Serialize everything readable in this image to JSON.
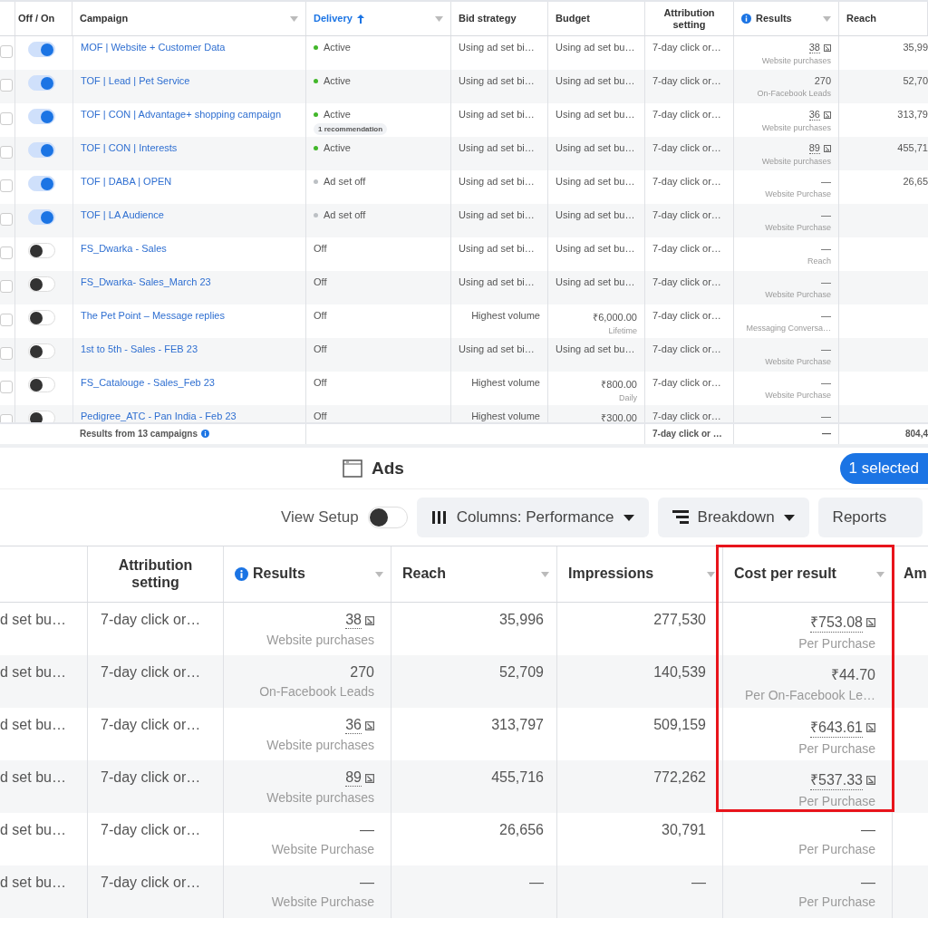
{
  "campaigns_table": {
    "columns": [
      {
        "label": "Off / On",
        "menu": false,
        "sorted": false,
        "info": false
      },
      {
        "label": "Campaign",
        "menu": true,
        "sorted": false,
        "info": false
      },
      {
        "label": "Delivery",
        "menu": true,
        "sorted": true,
        "info": false
      },
      {
        "label": "Bid strategy",
        "menu": false,
        "sorted": false,
        "info": false
      },
      {
        "label": "Budget",
        "menu": false,
        "sorted": false,
        "info": false
      },
      {
        "label": "Attribution setting",
        "menu": false,
        "sorted": false,
        "info": false
      },
      {
        "label": "Results",
        "menu": true,
        "sorted": false,
        "info": true
      },
      {
        "label": "Reach",
        "menu": false,
        "sorted": false,
        "info": false
      }
    ],
    "rows": [
      {
        "checked": false,
        "on": true,
        "campaign": "MOF | Website + Customer Data",
        "delivery": "Active",
        "color": "#42b72a",
        "bid_strategy": "Using ad set bi…",
        "budget": "Using ad set bu…",
        "attribution": "7-day click or…",
        "results": "38",
        "results_mark": true,
        "result_type": "Website purchases",
        "reach": "35,99"
      },
      {
        "checked": false,
        "on": true,
        "campaign": "TOF | Lead | Pet Service",
        "delivery": "Active",
        "color": "#42b72a",
        "bid_strategy": "Using ad set bi…",
        "budget": "Using ad set bu…",
        "attribution": "7-day click or…",
        "results": "270",
        "results_mark": false,
        "result_type": "On-Facebook Leads",
        "reach": "52,70"
      },
      {
        "checked": false,
        "on": true,
        "campaign": "TOF | CON | Advantage+ shopping campaign",
        "delivery": "Active",
        "color": "#42b72a",
        "recommendation": "1 recommendation",
        "bid_strategy": "Using ad set bi…",
        "budget": "Using ad set bu…",
        "attribution": "7-day click or…",
        "results": "36",
        "results_mark": true,
        "result_type": "Website purchases",
        "reach": "313,79"
      },
      {
        "checked": false,
        "on": true,
        "campaign": "TOF | CON | Interests",
        "delivery": "Active",
        "color": "#42b72a",
        "bid_strategy": "Using ad set bi…",
        "budget": "Using ad set bu…",
        "attribution": "7-day click or…",
        "results": "89",
        "results_mark": true,
        "result_type": "Website purchases",
        "reach": "455,71"
      },
      {
        "checked": false,
        "on": true,
        "campaign": "TOF | DABA | OPEN",
        "delivery": "Ad set off",
        "color": "#bcc0c4",
        "bid_strategy": "Using ad set bi…",
        "budget": "Using ad set bu…",
        "attribution": "7-day click or…",
        "results": "—",
        "results_mark": false,
        "result_type": "Website Purchase",
        "reach": "26,65"
      },
      {
        "checked": false,
        "on": true,
        "campaign": "TOF | LA Audience",
        "delivery": "Ad set off",
        "color": "#bcc0c4",
        "bid_strategy": "Using ad set bi…",
        "budget": "Using ad set bu…",
        "attribution": "7-day click or…",
        "results": "—",
        "results_mark": false,
        "result_type": "Website Purchase"
      },
      {
        "checked": false,
        "on": false,
        "campaign": "FS_Dwarka - Sales",
        "delivery": "Off",
        "bid_strategy": "Using ad set bi…",
        "budget": "Using ad set bu…",
        "attribution": "7-day click or…",
        "results": "—",
        "results_mark": false,
        "result_type": "Reach"
      },
      {
        "checked": false,
        "on": false,
        "campaign": "FS_Dwarka- Sales_March 23",
        "delivery": "Off",
        "bid_strategy": "Using ad set bi…",
        "budget": "Using ad set bu…",
        "attribution": "7-day click or…",
        "results": "—",
        "results_mark": false,
        "result_type": "Website Purchase"
      },
      {
        "checked": false,
        "on": false,
        "campaign": "The Pet Point – Message replies",
        "delivery": "Off",
        "bid_strategy": "Highest volume",
        "budget": "₹6,000.00",
        "budget_note": "Lifetime",
        "attribution": "7-day click or…",
        "results": "—",
        "results_mark": false,
        "result_type": "Messaging Conversa…"
      },
      {
        "checked": false,
        "on": false,
        "campaign": "1st to 5th - Sales - FEB 23",
        "delivery": "Off",
        "bid_strategy": "Using ad set bi…",
        "budget": "Using ad set bu…",
        "attribution": "7-day click or…",
        "results": "—",
        "results_mark": false,
        "result_type": "Website Purchase"
      },
      {
        "checked": false,
        "on": false,
        "campaign": "FS_Catalouge - Sales_Feb 23",
        "delivery": "Off",
        "bid_strategy": "Highest volume",
        "budget": "₹800.00",
        "budget_note": "Daily",
        "attribution": "7-day click or…",
        "results": "—",
        "results_mark": false,
        "result_type": "Website Purchase"
      },
      {
        "checked": false,
        "on": false,
        "campaign": "Pedigree_ATC - Pan India - Feb 23",
        "delivery": "Off",
        "bid_strategy": "Highest volume",
        "budget": "₹300.00",
        "attribution": "7-day click or…",
        "results": "—",
        "results_mark": false
      }
    ],
    "footer": {
      "summary": "Results from 13 campaigns",
      "attribution": "7-day click or …",
      "results": "—",
      "reach": "804,4"
    }
  },
  "ads_bar": {
    "title": "Ads",
    "selected_badge": "1 selected"
  },
  "toolbar": {
    "view_setup": {
      "label": "View Setup",
      "on": false
    },
    "buttons": [
      {
        "label": "Columns: Performance",
        "kind": "columns"
      },
      {
        "label": "Breakdown",
        "kind": "breakdown"
      },
      {
        "label": "Reports",
        "kind": "plain"
      }
    ]
  },
  "ads_table": {
    "columns": [
      {
        "label": "Attribution setting",
        "menu": false,
        "info": false
      },
      {
        "label": "Results",
        "menu": true,
        "info": true
      },
      {
        "label": "Reach",
        "menu": true,
        "info": false
      },
      {
        "label": "Impressions",
        "menu": true,
        "info": false
      },
      {
        "label": "Cost per result",
        "menu": true,
        "info": false,
        "highlighted": true
      },
      {
        "label": "Am",
        "menu": false,
        "info": false
      }
    ],
    "rows": [
      {
        "column_1": "d set bu…",
        "attribution": "7-day click or…",
        "results": "38",
        "results_mark": true,
        "result_type": "Website purchases",
        "reach": "35,996",
        "impressions": "277,530",
        "cost": "₹753.08",
        "cost_mark": true,
        "cost_type": "Per Purchase"
      },
      {
        "column_1": "d set bu…",
        "attribution": "7-day click or…",
        "results": "270",
        "results_mark": false,
        "result_type": "On-Facebook Leads",
        "reach": "52,709",
        "impressions": "140,539",
        "cost": "₹44.70",
        "cost_mark": false,
        "cost_type": "Per On-Facebook Le…"
      },
      {
        "column_1": "d set bu…",
        "attribution": "7-day click or…",
        "results": "36",
        "results_mark": true,
        "result_type": "Website purchases",
        "reach": "313,797",
        "impressions": "509,159",
        "cost": "₹643.61",
        "cost_mark": true,
        "cost_type": "Per Purchase"
      },
      {
        "column_1": "d set bu…",
        "attribution": "7-day click or…",
        "results": "89",
        "results_mark": true,
        "result_type": "Website purchases",
        "reach": "455,716",
        "impressions": "772,262",
        "cost": "₹537.33",
        "cost_mark": true,
        "cost_type": "Per Purchase"
      },
      {
        "column_1": "d set bu…",
        "attribution": "7-day click or…",
        "results": "—",
        "results_mark": false,
        "result_type": "Website Purchase",
        "reach": "26,656",
        "impressions": "30,791",
        "cost": "—",
        "cost_mark": false,
        "cost_type": "Per Purchase"
      },
      {
        "column_1": "d set bu…",
        "attribution": "7-day click or…",
        "results": "—",
        "results_mark": false,
        "result_type": "Website Purchase",
        "reach": "—",
        "impressions": "—",
        "cost": "—",
        "cost_mark": false,
        "cost_type": "Per Purchase"
      }
    ]
  }
}
